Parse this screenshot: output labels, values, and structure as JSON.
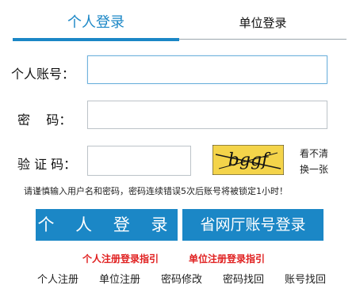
{
  "tabs": {
    "personal": "个人登录",
    "unit": "单位登录"
  },
  "form": {
    "account_label": "个人账号：",
    "password_label": "密    码：",
    "captcha_label": "验 证 码：",
    "account_value": "",
    "password_value": "",
    "captcha_value": "",
    "captcha_text": "bggf",
    "refresh_line1": "看不清",
    "refresh_line2": "换一张"
  },
  "notice": "请谨慎输入用户名和密码，密码连续错误5次后账号将被锁定1小时！",
  "buttons": {
    "login": "个 人 登 录",
    "province": "省网厅账号登录"
  },
  "guides": {
    "personal_reg": "个人注册登录指引",
    "unit_reg": "单位注册登录指引"
  },
  "footer": {
    "personal_register": "个人注册",
    "unit_register": "单位注册",
    "change_password": "密码修改",
    "retrieve_password": "密码找回",
    "retrieve_account": "账号找回"
  },
  "colors": {
    "accent": "#1b87c6",
    "guide_red": "#e02020",
    "captcha_bg": "#f4d44a"
  }
}
